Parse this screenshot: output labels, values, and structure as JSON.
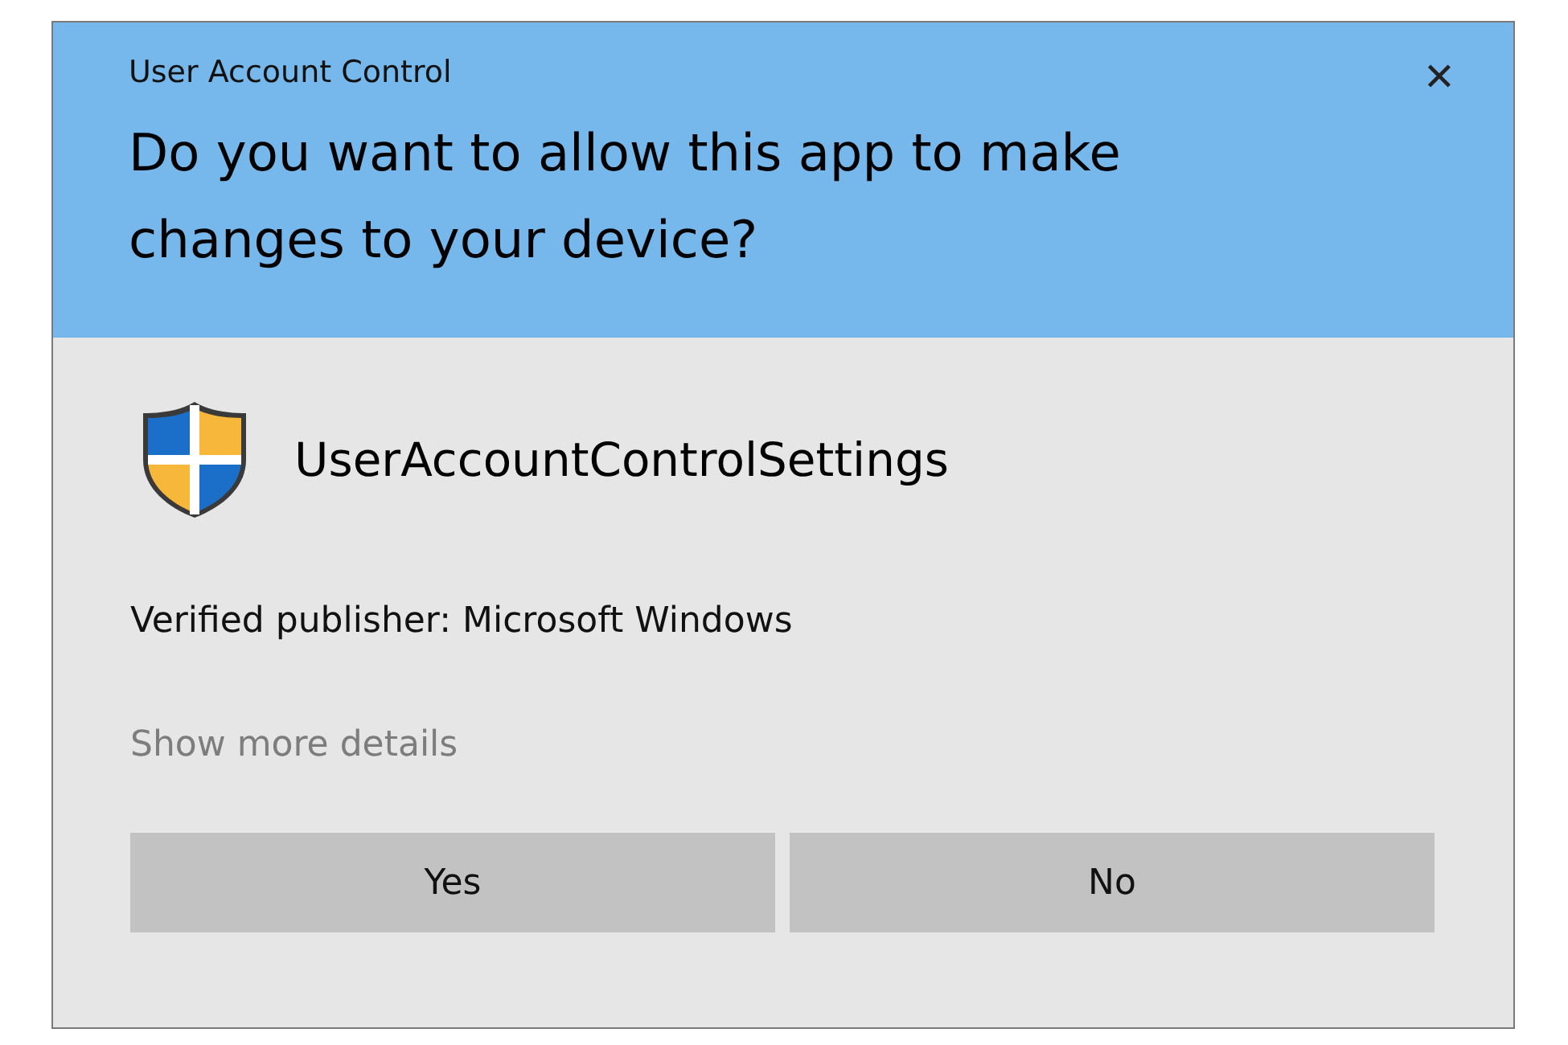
{
  "window": {
    "title": "User Account Control",
    "close": "✕"
  },
  "heading": "Do you want to allow this app to make changes to your device?",
  "app": {
    "name": "UserAccountControlSettings"
  },
  "publisher": "Verified publisher: Microsoft Windows",
  "details_link": "Show more details",
  "buttons": [
    {
      "label": "Yes"
    },
    {
      "label": "No"
    }
  ]
}
